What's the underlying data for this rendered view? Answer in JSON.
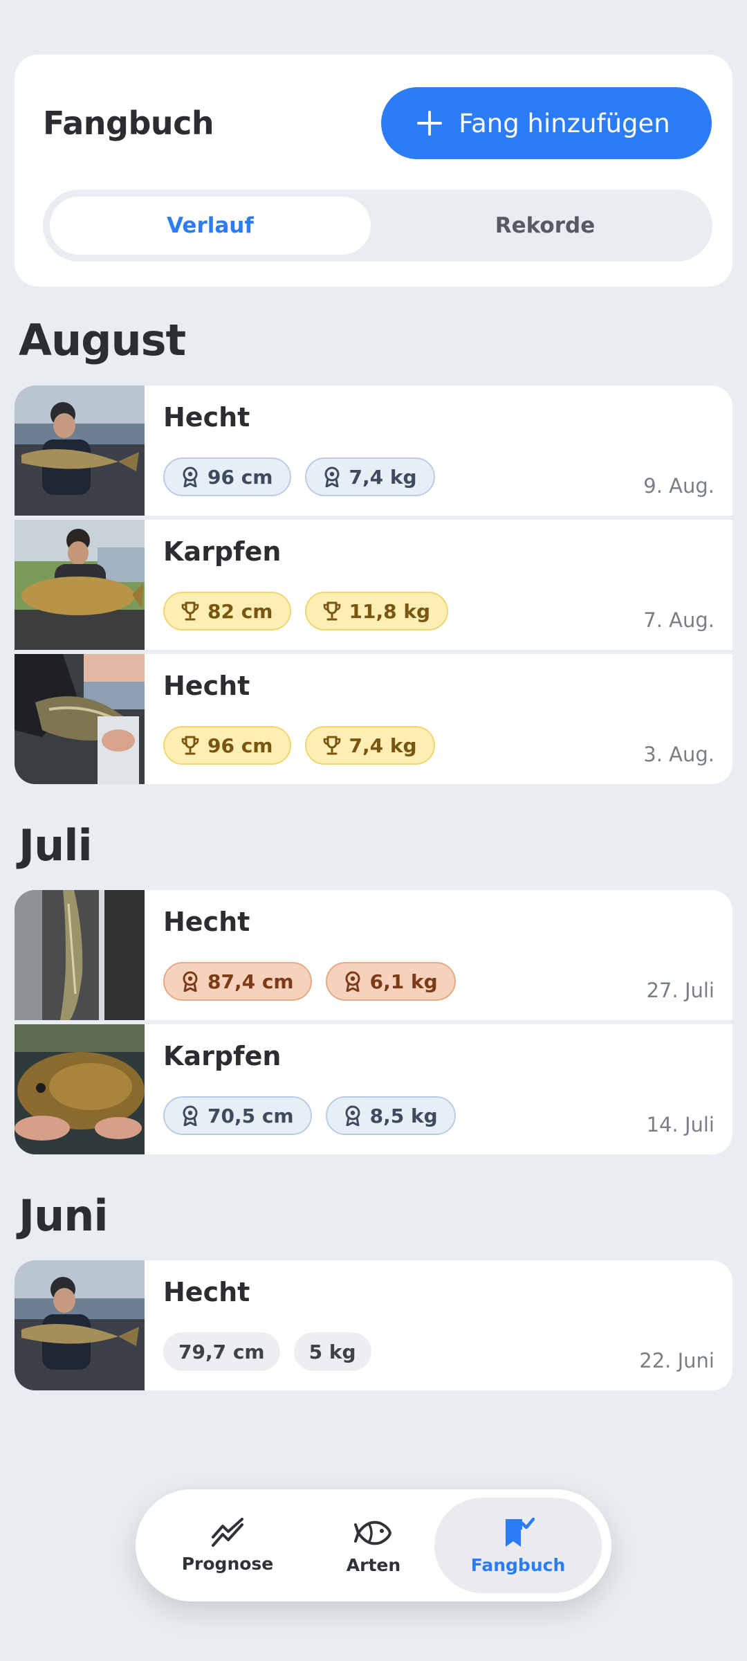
{
  "header": {
    "title": "Fangbuch",
    "add_button": "Fang hinzufügen",
    "tabs": [
      {
        "label": "Verlauf",
        "active": true
      },
      {
        "label": "Rekorde",
        "active": false
      }
    ]
  },
  "months": [
    {
      "name": "August",
      "entries": [
        {
          "species": "Hecht",
          "length": "96 cm",
          "weight": "7,4 kg",
          "badge": "blue",
          "badge_icon": "medal-icon",
          "date": "9. Aug."
        },
        {
          "species": "Karpfen",
          "length": "82 cm",
          "weight": "11,8 kg",
          "badge": "gold",
          "badge_icon": "trophy-icon",
          "date": "7. Aug."
        },
        {
          "species": "Hecht",
          "length": "96 cm",
          "weight": "7,4 kg",
          "badge": "gold",
          "badge_icon": "trophy-icon",
          "date": "3. Aug."
        }
      ]
    },
    {
      "name": "Juli",
      "entries": [
        {
          "species": "Hecht",
          "length": "87,4 cm",
          "weight": "6,1 kg",
          "badge": "bronze",
          "badge_icon": "medal-icon",
          "date": "27. Juli"
        },
        {
          "species": "Karpfen",
          "length": "70,5 cm",
          "weight": "8,5 kg",
          "badge": "blue",
          "badge_icon": "medal-icon",
          "date": "14. Juli"
        }
      ]
    },
    {
      "name": "Juni",
      "entries": [
        {
          "species": "Hecht",
          "length": "79,7 cm",
          "weight": "5 kg",
          "badge": "plain",
          "badge_icon": "",
          "date": "22. Juni"
        }
      ]
    }
  ],
  "bottom_nav": [
    {
      "label": "Prognose",
      "icon": "trend-icon",
      "active": false
    },
    {
      "label": "Arten",
      "icon": "fish-icon",
      "active": false
    },
    {
      "label": "Fangbuch",
      "icon": "bookmark-check-icon",
      "active": true
    }
  ],
  "colors": {
    "accent": "#2b7cf6",
    "background": "#e9edf1",
    "gold_badge": "#fdeeb3",
    "blue_badge": "#e6eef7",
    "bronze_badge": "#f6d2bd"
  }
}
